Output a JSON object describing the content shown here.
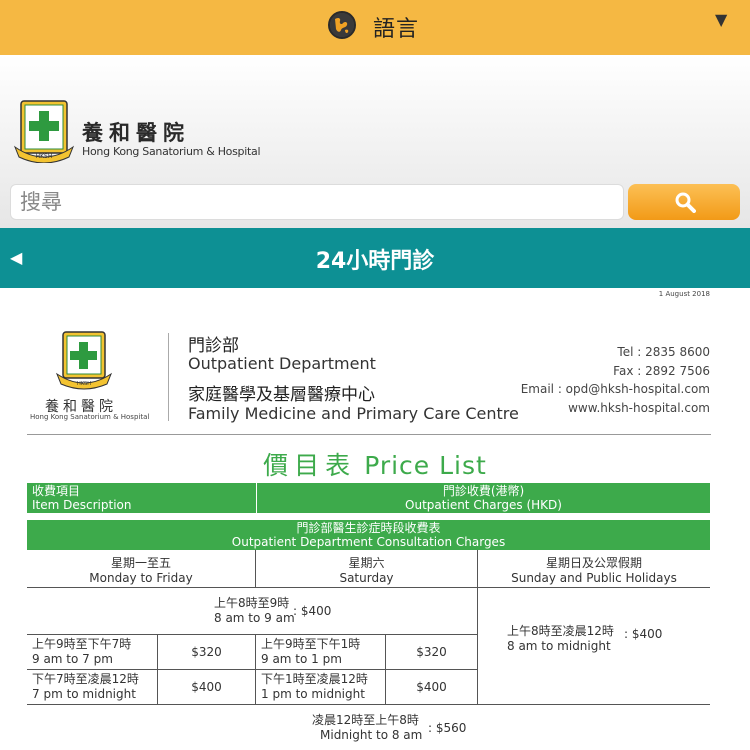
{
  "language_bar": {
    "label": "語言",
    "globe_icon": "globe-icon",
    "dropdown_icon": "triangle-down-icon"
  },
  "header": {
    "hospital_name_cn": "養和醫院",
    "hospital_name_en": "Hong Kong Sanatorium & Hospital",
    "search_placeholder": "搜尋",
    "search_icon": "magnifier-icon"
  },
  "nav": {
    "title": "24小時門診",
    "back_icon": "triangle-left-icon"
  },
  "document": {
    "date": "1 August 2018",
    "logo_name_cn": "養和醫院",
    "logo_name_en": "Hong Kong Sanatorium & Hospital",
    "dept_cn": "門診部",
    "dept_en": "Outpatient Department",
    "centre_cn": "家庭醫學及基層醫療中心",
    "centre_en": "Family Medicine and Primary Care Centre",
    "tel": "Tel : 2835 8600",
    "fax": "Fax : 2892 7506",
    "email": "Email : opd@hksh-hospital.com",
    "web": "www.hksh-hospital.com",
    "price_title_cn": "價目表",
    "price_title_en": "Price List",
    "header_item_cn": "收費項目",
    "header_item_en": "Item Description",
    "header_charge_cn": "門診收費(港幣)",
    "header_charge_en": "Outpatient Charges (HKD)",
    "section_cn": "門診部醫生診症時段收費表",
    "section_en": "Outpatient Department Consultation Charges",
    "cols": [
      {
        "cn": "星期一至五",
        "en": "Monday to Friday"
      },
      {
        "cn": "星期六",
        "en": "Saturday"
      },
      {
        "cn": "星期日及公眾假期",
        "en": "Sunday and Public Holidays"
      }
    ],
    "early": {
      "cn": "上午8時至9時",
      "en": "8 am to 9 am",
      "price": ": $400"
    },
    "holiday": {
      "cn": "上午8時至凌晨12時",
      "en": "8 am to midnight",
      "price": ": $400"
    },
    "weekday_day": {
      "cn": "上午9時至下午7時",
      "en": "9 am to 7 pm",
      "price": "$320"
    },
    "weekday_eve": {
      "cn": "下午7時至凌晨12時",
      "en": "7 pm to midnight",
      "price": "$400"
    },
    "sat_day": {
      "cn": "上午9時至下午1時",
      "en": "9 am to 1 pm",
      "price": "$320"
    },
    "sat_eve": {
      "cn": "下午1時至凌晨12時",
      "en": "1 pm to midnight",
      "price": "$400"
    },
    "night": {
      "cn": "凌晨12時至上午8時",
      "en": "Midnight to 8 am",
      "price": ": $560"
    }
  }
}
